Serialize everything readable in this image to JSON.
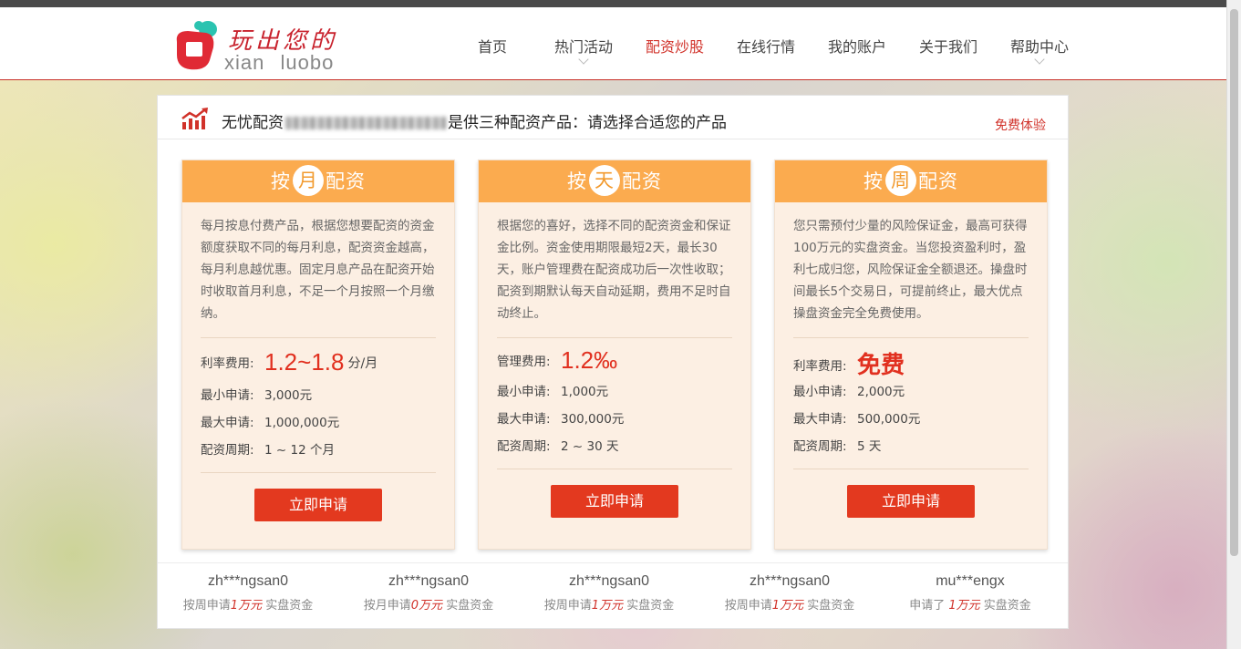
{
  "logo": {
    "cn": "玩出您的",
    "en": "xian  luobo"
  },
  "nav": [
    {
      "label": "首页",
      "has_dropdown": false,
      "active": false
    },
    {
      "label": "热门活动",
      "has_dropdown": true,
      "active": false
    },
    {
      "label": "配资炒股",
      "has_dropdown": false,
      "active": true
    },
    {
      "label": "在线行情",
      "has_dropdown": false,
      "active": false
    },
    {
      "label": "我的账户",
      "has_dropdown": false,
      "active": false
    },
    {
      "label": "关于我们",
      "has_dropdown": false,
      "active": false
    },
    {
      "label": "帮助中心",
      "has_dropdown": true,
      "active": false
    }
  ],
  "panel": {
    "title_prefix": "无忧配资",
    "title_suffix": "是供三种配资产品：请选择合适您的产品",
    "free_trial": "免费体验"
  },
  "cards": [
    {
      "head_pre": "按",
      "head_circle": "月",
      "head_post": "配资",
      "desc": "每月按息付费产品，根据您想要配资的资金额度获取不同的每月利息，配资资金越高，每月利息越优惠。固定月息产品在配资开始时收取首月利息，不足一个月按照一个月缴纳。",
      "fee_label": "利率费用:",
      "fee_value": "1.2~1.8",
      "fee_unit": "分/月",
      "min_label": "最小申请:",
      "min_value": "3,000元",
      "max_label": "最大申请:",
      "max_value": "1,000,000元",
      "period_label": "配资周期:",
      "period_value": "1 ~ 12 个月",
      "button": "立即申请"
    },
    {
      "head_pre": "按",
      "head_circle": "天",
      "head_post": "配资",
      "desc": "根据您的喜好，选择不同的配资资金和保证金比例。资金使用期限最短2天，最长30天，账户管理费在配资成功后一次性收取；配资到期默认每天自动延期，费用不足时自动终止。",
      "fee_label": "管理费用:",
      "fee_value": "1.2‰",
      "fee_unit": "",
      "min_label": "最小申请:",
      "min_value": "1,000元",
      "max_label": "最大申请:",
      "max_value": "300,000元",
      "period_label": "配资周期:",
      "period_value": "2 ~ 30 天",
      "button": "立即申请"
    },
    {
      "head_pre": "按",
      "head_circle": "周",
      "head_post": "配资",
      "desc": "您只需预付少量的风险保证金，最高可获得100万元的实盘资金。当您投资盈利时，盈利七成归您，风险保证金全额退还。操盘时间最长5个交易日，可提前终止，最大优点操盘资金完全免费使用。",
      "fee_label": "利率费用:",
      "fee_value": "免费",
      "fee_unit": "",
      "min_label": "最小申请:",
      "min_value": "2,000元",
      "max_label": "最大申请:",
      "max_value": "500,000元",
      "period_label": "配资周期:",
      "period_value": "5 天",
      "button": "立即申请"
    }
  ],
  "feed": [
    {
      "name": "zh***ngsan0",
      "pre": "按周申请",
      "amount": "1万元",
      "post": " 实盘资金"
    },
    {
      "name": "zh***ngsan0",
      "pre": "按月申请",
      "amount": "0万元",
      "post": " 实盘资金"
    },
    {
      "name": "zh***ngsan0",
      "pre": "按周申请",
      "amount": "1万元",
      "post": " 实盘资金"
    },
    {
      "name": "zh***ngsan0",
      "pre": "按周申请",
      "amount": "1万元",
      "post": " 实盘资金"
    },
    {
      "name": "mu***engx",
      "pre": "申请了 ",
      "amount": "1万元",
      "post": " 实盘资金"
    }
  ],
  "colors": {
    "brand_red": "#d1322a",
    "card_head": "#fbab4f",
    "button": "#e3391f",
    "card_bg": "#fcefe3"
  }
}
